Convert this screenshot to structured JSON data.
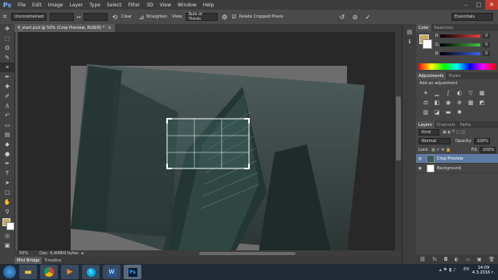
{
  "app": {
    "logo": "Ps"
  },
  "menu": [
    "File",
    "Edit",
    "Image",
    "Layer",
    "Type",
    "Select",
    "Filter",
    "3D",
    "View",
    "Window",
    "Help"
  ],
  "window_controls": {
    "min": "–",
    "max": "□",
    "close": "✕"
  },
  "options": {
    "ratio_select": "Unconstrained",
    "swap_icon": "↔",
    "clear_label": "Clear",
    "straighten_label": "Straighten",
    "view_label": "View:",
    "view_select": "Rule of Thirds",
    "delete_cropped_label": "Delete Cropped Pixels",
    "delete_cropped_checked": true,
    "workspace": "Essentials"
  },
  "document": {
    "tab_title": "8_start.psd @ 50% (Crop Preview, RGB/8) *",
    "zoom": "50%",
    "doc_info": "Doc: 4,40M/0 bytes"
  },
  "bottom_tabs": [
    "Mini Bridge",
    "Timeline"
  ],
  "panels": {
    "color_tabs": [
      "Color",
      "Swatches"
    ],
    "color_sliders": [
      {
        "name": "R",
        "value": "0"
      },
      {
        "name": "G",
        "value": "0"
      },
      {
        "name": "B",
        "value": "0"
      }
    ],
    "adjust_tabs": [
      "Adjustments",
      "Styles"
    ],
    "adjust_heading": "Add an adjustment",
    "layers_tabs": [
      "Layers",
      "Channels",
      "Paths"
    ],
    "kind_label": "Kind",
    "blend_mode": "Normal",
    "opacity_label": "Opacity:",
    "opacity_value": "100%",
    "lock_label": "Lock:",
    "fill_label": "Fill:",
    "fill_value": "100%",
    "layers": [
      {
        "name": "Crop Preview",
        "selected": true
      },
      {
        "name": "Background",
        "selected": false
      }
    ]
  },
  "taskbar": {
    "lang": "EN",
    "time": "14:09",
    "date": "4.3.2016 г."
  },
  "colors": {
    "accent": "#5d7aa3",
    "taskbar": "#1f2a36"
  }
}
